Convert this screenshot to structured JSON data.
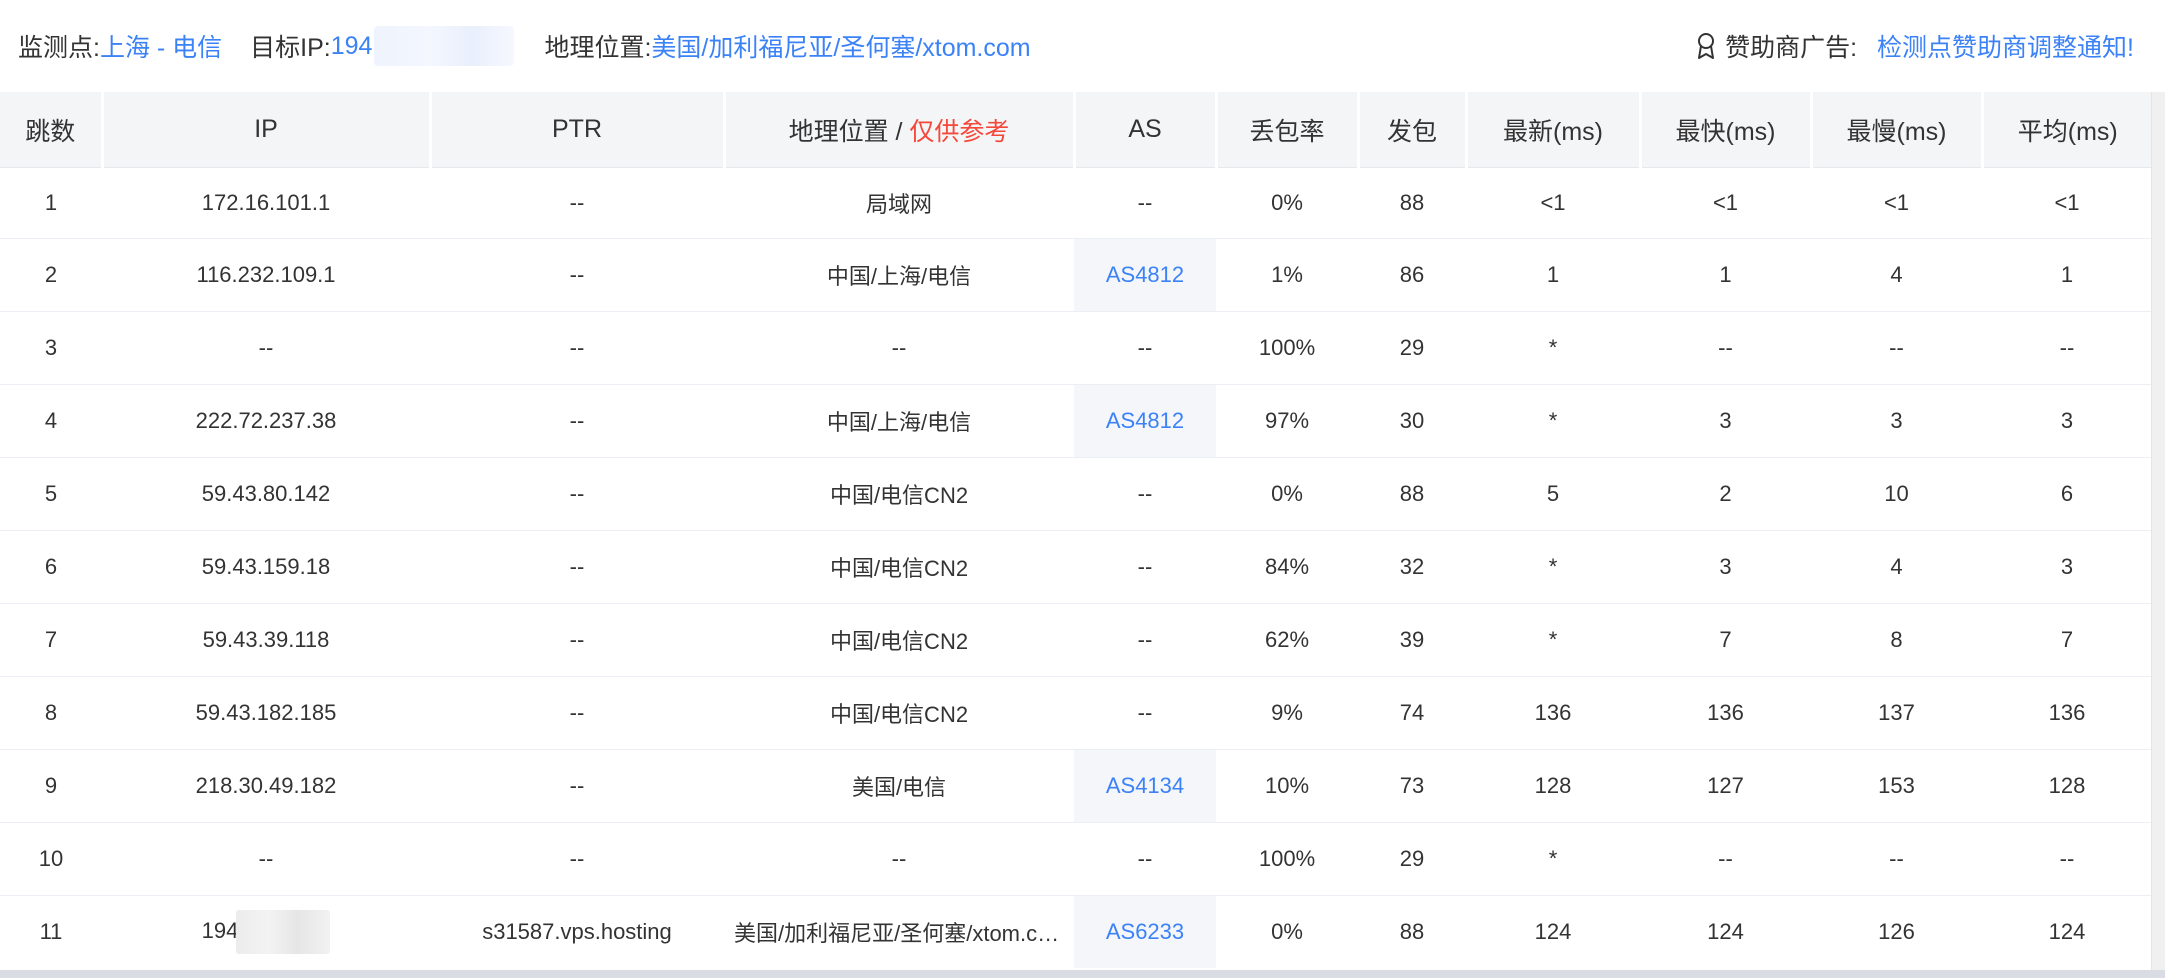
{
  "header": {
    "monitor_label": "监测点:",
    "monitor_value": "上海 - 电信",
    "target_label": "目标IP:",
    "target_value": "194",
    "geo_label": "地理位置:",
    "geo_value": "美国/加利福尼亚/圣何塞/xtom.com",
    "sponsor_label": "赞助商广告:",
    "sponsor_link": "检测点赞助商调整通知!",
    "sponsor_icon": "award-icon"
  },
  "table": {
    "columns": {
      "hop": "跳数",
      "ip": "IP",
      "ptr": "PTR",
      "geo": "地理位置 / ",
      "geo_note": "仅供参考",
      "as": "AS",
      "loss": "丢包率",
      "sent": "发包",
      "last": "最新(ms)",
      "best": "最快(ms)",
      "worst": "最慢(ms)",
      "avg": "平均(ms)"
    },
    "rows": [
      {
        "hop": "1",
        "ip": "172.16.101.1",
        "ptr": "--",
        "geo": "局域网",
        "as": "--",
        "loss": "0%",
        "sent": "88",
        "last": "<1",
        "best": "<1",
        "worst": "<1",
        "avg": "<1"
      },
      {
        "hop": "2",
        "ip": "116.232.109.1",
        "ptr": "--",
        "geo": "中国/上海/电信",
        "as": "AS4812",
        "loss": "1%",
        "sent": "86",
        "last": "1",
        "best": "1",
        "worst": "4",
        "avg": "1"
      },
      {
        "hop": "3",
        "ip": "--",
        "ptr": "--",
        "geo": "--",
        "as": "--",
        "loss": "100%",
        "sent": "29",
        "last": "*",
        "best": "--",
        "worst": "--",
        "avg": "--"
      },
      {
        "hop": "4",
        "ip": "222.72.237.38",
        "ptr": "--",
        "geo": "中国/上海/电信",
        "as": "AS4812",
        "loss": "97%",
        "sent": "30",
        "last": "*",
        "best": "3",
        "worst": "3",
        "avg": "3"
      },
      {
        "hop": "5",
        "ip": "59.43.80.142",
        "ptr": "--",
        "geo": "中国/电信CN2",
        "as": "--",
        "loss": "0%",
        "sent": "88",
        "last": "5",
        "best": "2",
        "worst": "10",
        "avg": "6"
      },
      {
        "hop": "6",
        "ip": "59.43.159.18",
        "ptr": "--",
        "geo": "中国/电信CN2",
        "as": "--",
        "loss": "84%",
        "sent": "32",
        "last": "*",
        "best": "3",
        "worst": "4",
        "avg": "3"
      },
      {
        "hop": "7",
        "ip": "59.43.39.118",
        "ptr": "--",
        "geo": "中国/电信CN2",
        "as": "--",
        "loss": "62%",
        "sent": "39",
        "last": "*",
        "best": "7",
        "worst": "8",
        "avg": "7"
      },
      {
        "hop": "8",
        "ip": "59.43.182.185",
        "ptr": "--",
        "geo": "中国/电信CN2",
        "as": "--",
        "loss": "9%",
        "sent": "74",
        "last": "136",
        "best": "136",
        "worst": "137",
        "avg": "136"
      },
      {
        "hop": "9",
        "ip": "218.30.49.182",
        "ptr": "--",
        "geo": "美国/电信",
        "as": "AS4134",
        "loss": "10%",
        "sent": "73",
        "last": "128",
        "best": "127",
        "worst": "153",
        "avg": "128"
      },
      {
        "hop": "10",
        "ip": "--",
        "ptr": "--",
        "geo": "--",
        "as": "--",
        "loss": "100%",
        "sent": "29",
        "last": "*",
        "best": "--",
        "worst": "--",
        "avg": "--"
      },
      {
        "hop": "11",
        "ip": "194",
        "ptr": "s31587.vps.hosting",
        "geo": "美国/加利福尼亚/圣何塞/xtom.com",
        "as": "AS6233",
        "loss": "0%",
        "sent": "88",
        "last": "124",
        "best": "124",
        "worst": "126",
        "avg": "124"
      }
    ]
  }
}
